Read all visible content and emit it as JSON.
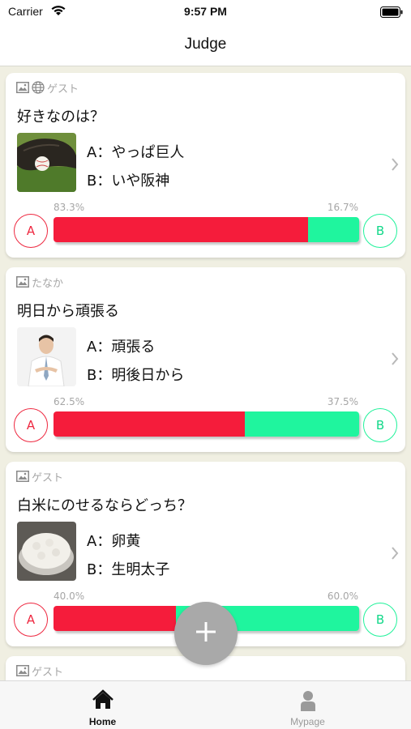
{
  "status_bar": {
    "carrier": "Carrier",
    "time": "9:57 PM"
  },
  "nav": {
    "title": "Judge"
  },
  "posts": [
    {
      "author": "ゲスト",
      "show_globe": true,
      "question": "好きなのは？",
      "thumbnail": "baseball-glove-photo",
      "option_a": "A：やっぱ巨人",
      "option_b": "B：いや阪神",
      "percent_a": "83.3%",
      "percent_b": "16.7%",
      "share_a": 0.833,
      "button_a": "A",
      "button_b": "B"
    },
    {
      "author": "たなか",
      "show_globe": false,
      "question": "明日から頑張る",
      "thumbnail": "man-portrait-photo",
      "option_a": "A：頑張る",
      "option_b": "B：明後日から",
      "percent_a": "62.5%",
      "percent_b": "37.5%",
      "share_a": 0.625,
      "button_a": "A",
      "button_b": "B"
    },
    {
      "author": "ゲスト",
      "show_globe": false,
      "question": "白米にのせるならどっち？",
      "thumbnail": "rice-bowl-photo",
      "option_a": "A：卵黄",
      "option_b": "B：生明太子",
      "percent_a": "40.0%",
      "percent_b": "60.0%",
      "share_a": 0.4,
      "button_a": "A",
      "button_b": "B"
    },
    {
      "author": "ゲスト",
      "show_globe": false
    }
  ],
  "fab": {
    "icon": "plus-icon"
  },
  "tabs": [
    {
      "label": "Home",
      "icon": "home-icon",
      "active": true
    },
    {
      "label": "Mypage",
      "icon": "person-icon",
      "active": false
    }
  ],
  "colors": {
    "option_a": "#f51c3b",
    "option_b": "#1ff59e",
    "background": "#f0efe2"
  }
}
